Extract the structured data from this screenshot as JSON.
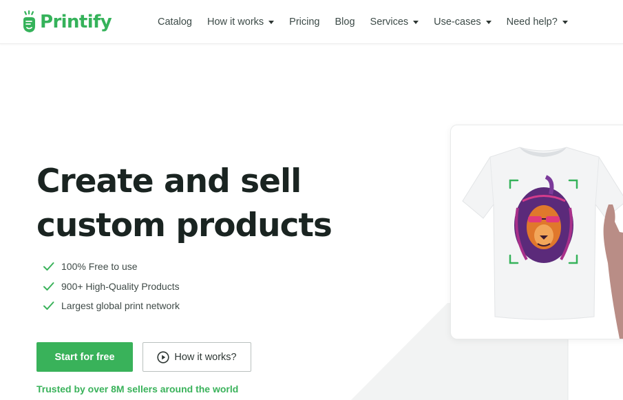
{
  "brand": {
    "name": "Printify",
    "logo_icon": "printify-hand-logo-icon",
    "color": "#35b25a"
  },
  "nav": {
    "items": [
      {
        "label": "Catalog",
        "dropdown": false
      },
      {
        "label": "How it works",
        "dropdown": true
      },
      {
        "label": "Pricing",
        "dropdown": false
      },
      {
        "label": "Blog",
        "dropdown": false
      },
      {
        "label": "Services",
        "dropdown": true
      },
      {
        "label": "Use-cases",
        "dropdown": true
      },
      {
        "label": "Need help?",
        "dropdown": true
      }
    ]
  },
  "hero": {
    "title_line1": "Create and sell",
    "title_line2": "custom products",
    "features": [
      "100% Free to use",
      "900+ High-Quality Products",
      "Largest global print network"
    ],
    "feature_icon": "check-icon",
    "primary_cta": "Start for free",
    "secondary_cta": "How it works?",
    "secondary_icon": "play-circle-icon",
    "trusted": "Trusted by over 8M sellers around the world"
  },
  "colors": {
    "accent": "#39b25a",
    "heading": "#1a2421",
    "body_text": "#3f4a47"
  }
}
